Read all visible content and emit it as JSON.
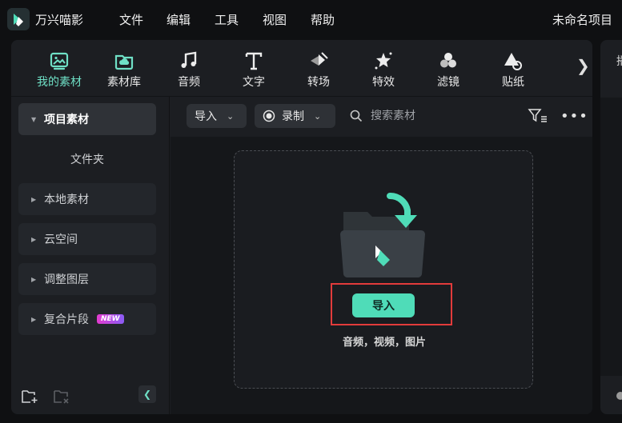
{
  "app": {
    "name": "万兴喵影",
    "project_name": "未命名项目"
  },
  "menu": [
    "文件",
    "编辑",
    "工具",
    "视图",
    "帮助"
  ],
  "toolbar": {
    "tabs": [
      {
        "label": "我的素材",
        "icon": "my-media-icon",
        "active": true
      },
      {
        "label": "素材库",
        "icon": "cloud-library-icon",
        "active": false
      },
      {
        "label": "音频",
        "icon": "music-note-icon",
        "active": false
      },
      {
        "label": "文字",
        "icon": "text-icon",
        "active": false
      },
      {
        "label": "转场",
        "icon": "transition-icon",
        "active": false
      },
      {
        "label": "特效",
        "icon": "effects-star-icon",
        "active": false
      },
      {
        "label": "滤镜",
        "icon": "filter-circles-icon",
        "active": false
      },
      {
        "label": "贴纸",
        "icon": "sticker-icon",
        "active": false
      }
    ],
    "next_arrow": "❯"
  },
  "right_panel": {
    "tab_glyph": "播"
  },
  "sidebar": {
    "items": [
      {
        "label": "项目素材",
        "active": true
      },
      {
        "label": "文件夹"
      },
      {
        "label": "本地素材"
      },
      {
        "label": "云空间"
      },
      {
        "label": "调整图层"
      },
      {
        "label": "复合片段",
        "badge": "NEW"
      }
    ],
    "collapse_glyph": "❮"
  },
  "content": {
    "import_dropdown": "导入",
    "record_dropdown": "录制",
    "search_placeholder": "搜索素材",
    "more_glyph": "•••",
    "drop_zone": {
      "import_button": "导入",
      "hint": "音频，视频，图片"
    }
  },
  "colors": {
    "accent": "#4fdcb8",
    "highlight": "#e23b3b",
    "badge_from": "#e43ccf",
    "badge_to": "#8a5cf5"
  }
}
